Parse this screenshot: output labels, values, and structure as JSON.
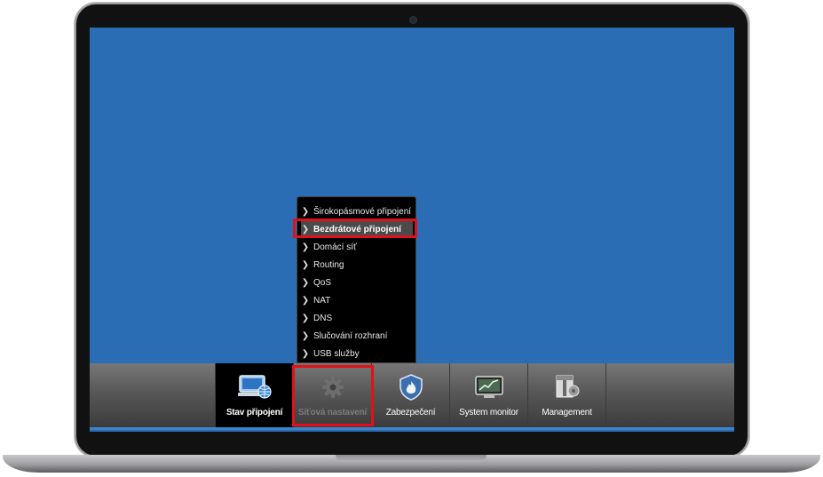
{
  "colors": {
    "desktop": "#2a6db5",
    "highlight": "#e3101a",
    "taskbar_accent": "#3c83c8"
  },
  "submenu": {
    "items": [
      {
        "label": "Širokopásmové připojení",
        "selected": false
      },
      {
        "label": "Bezdrátové připojení",
        "selected": true
      },
      {
        "label": "Domácí síť",
        "selected": false
      },
      {
        "label": "Routing",
        "selected": false
      },
      {
        "label": "QoS",
        "selected": false
      },
      {
        "label": "NAT",
        "selected": false
      },
      {
        "label": "DNS",
        "selected": false
      },
      {
        "label": "Slučování rozhraní",
        "selected": false
      },
      {
        "label": "USB služby",
        "selected": false
      }
    ]
  },
  "taskbar": {
    "items": [
      {
        "label": "Stav připojení",
        "icon": "monitor-globe-icon",
        "state": "active"
      },
      {
        "label": "Síťová nastavení",
        "icon": "gear-icon",
        "state": "highlighted"
      },
      {
        "label": "Zabezpečení",
        "icon": "shield-flame-icon",
        "state": "normal"
      },
      {
        "label": "System monitor",
        "icon": "chart-monitor-icon",
        "state": "normal"
      },
      {
        "label": "Management",
        "icon": "tools-icon",
        "state": "normal"
      }
    ]
  }
}
